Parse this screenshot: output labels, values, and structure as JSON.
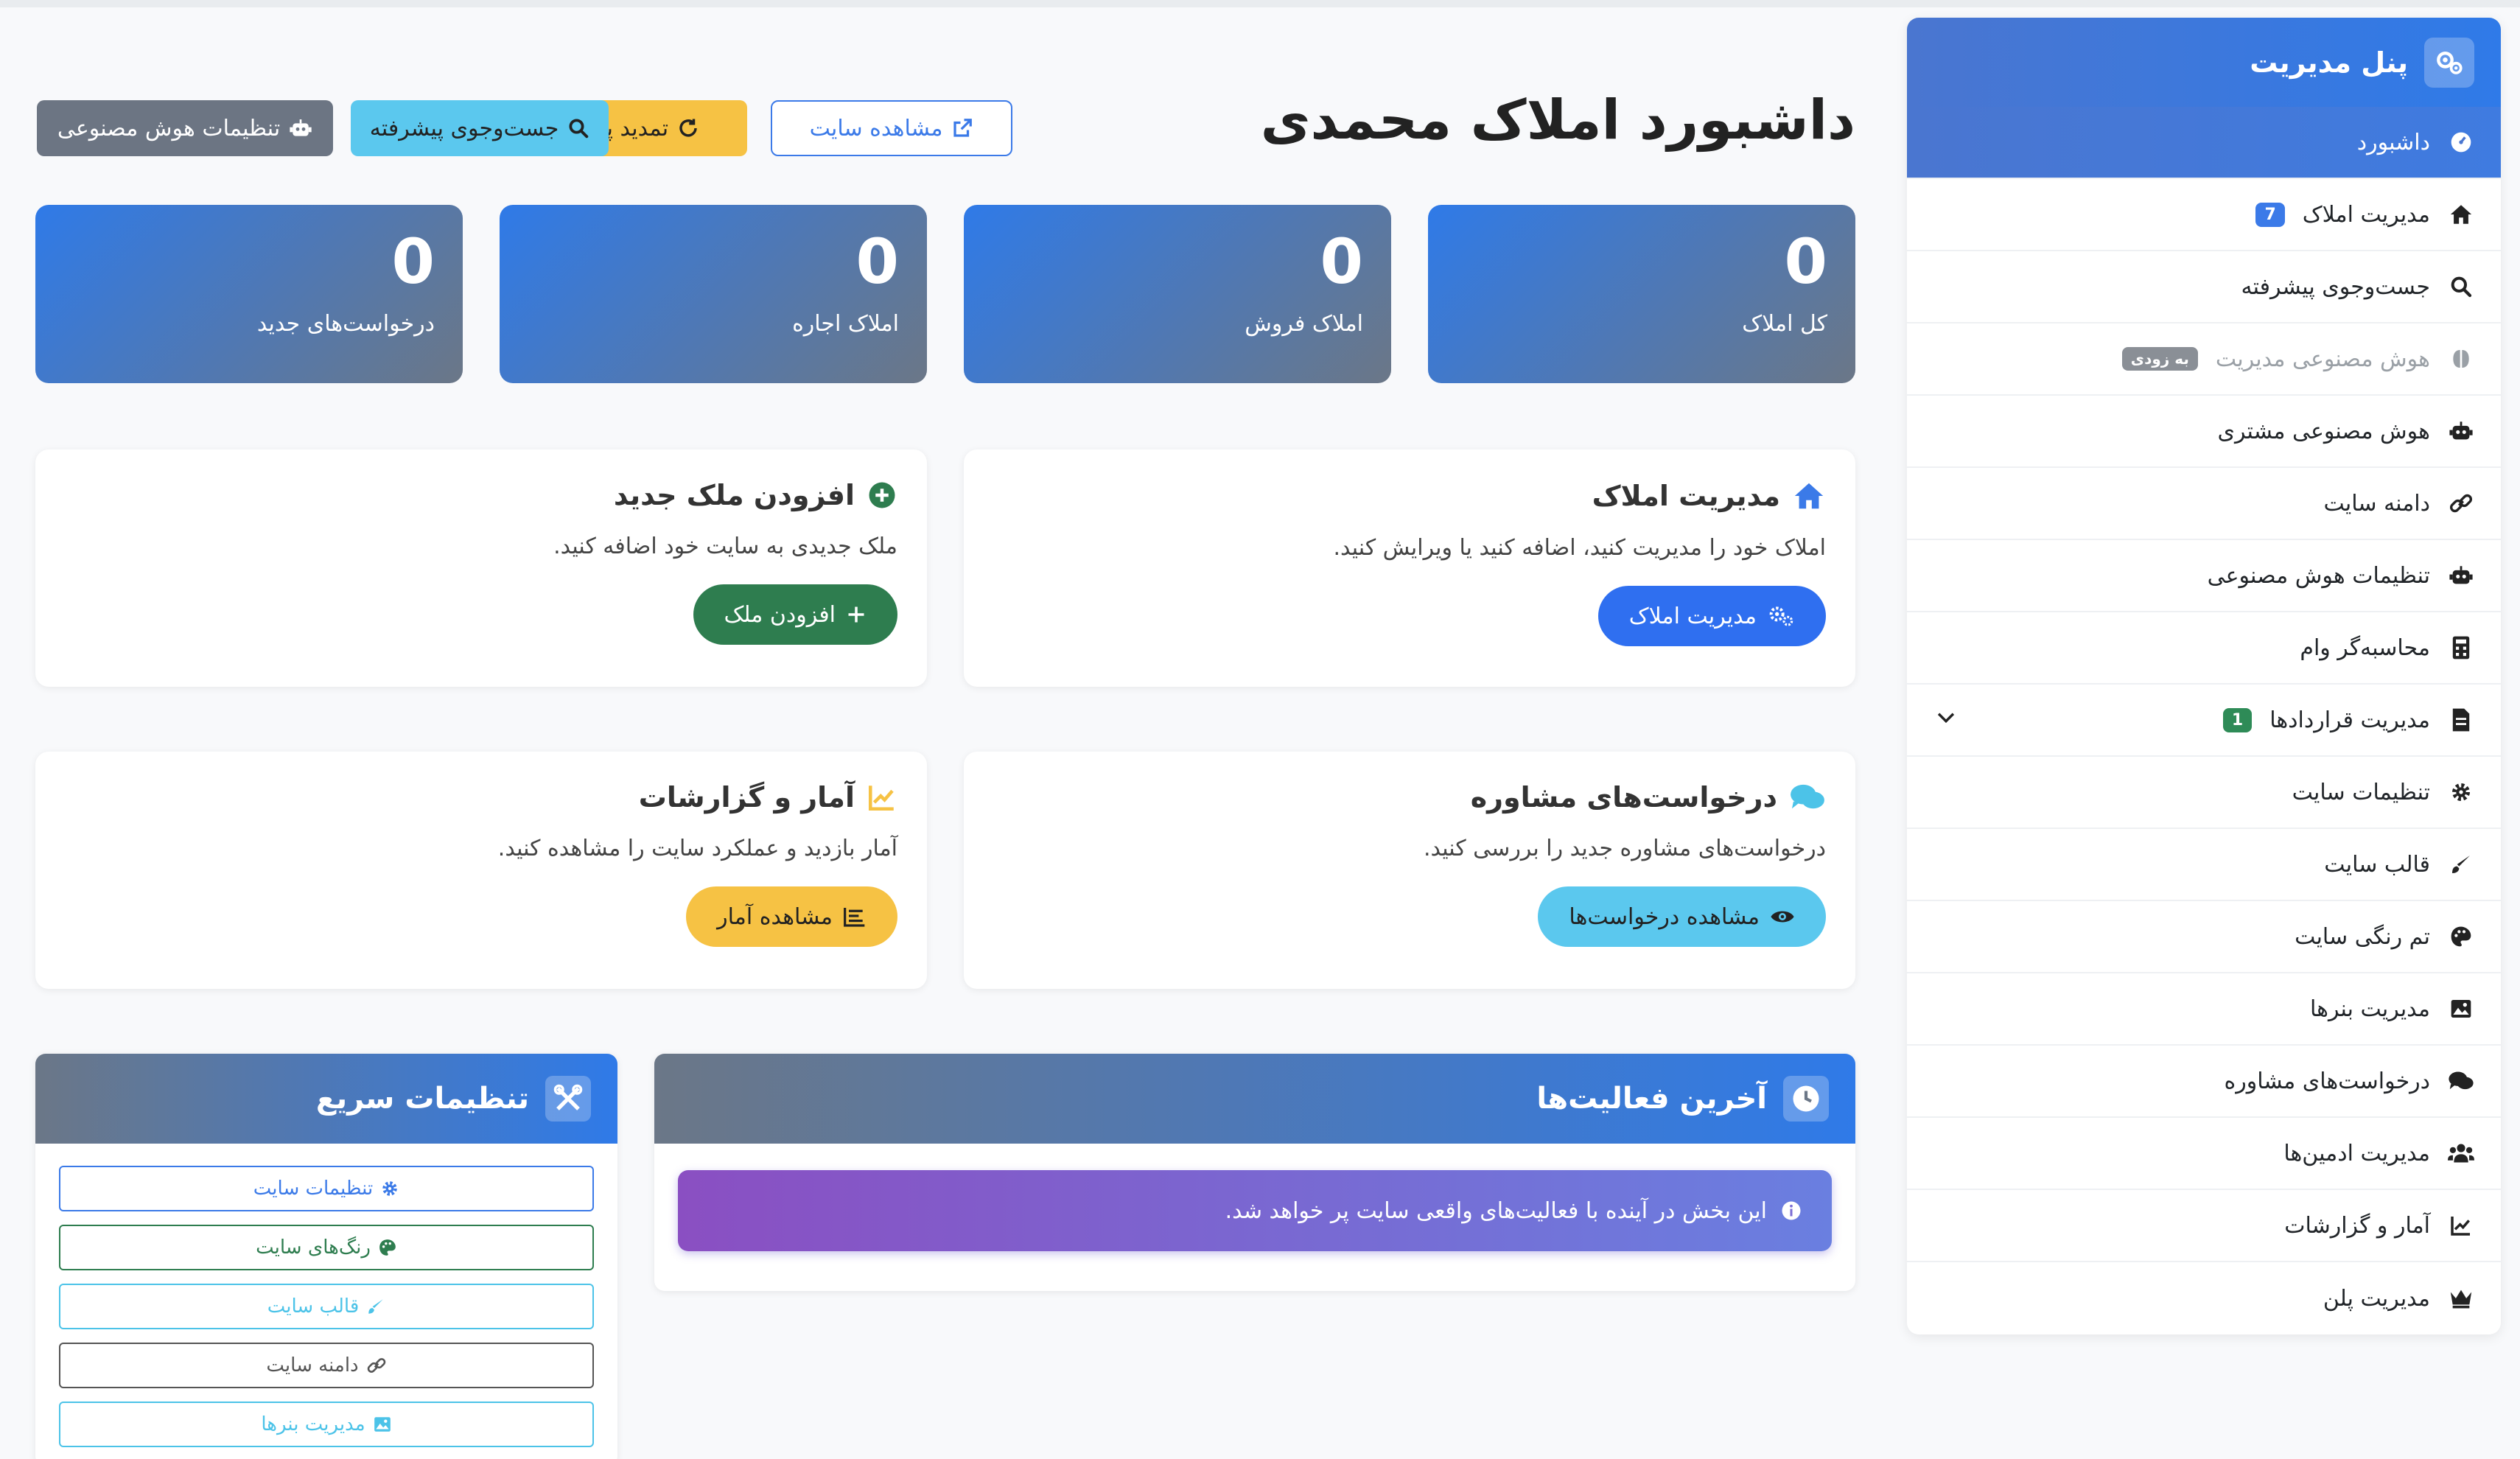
{
  "sidebar": {
    "title": "پنل مدیریت",
    "items": [
      {
        "label": "داشبورد",
        "icon": "dashboard-icon"
      },
      {
        "label": "مدیریت املاک",
        "icon": "home-icon",
        "badge": "7"
      },
      {
        "label": "جست‌وجوی پیشرفته",
        "icon": "search-icon"
      },
      {
        "label": "هوش مصنوعی مدیریت",
        "icon": "brain-icon",
        "badge": "به زودی"
      },
      {
        "label": "هوش مصنوعی مشتری",
        "icon": "robot-icon"
      },
      {
        "label": "دامنه سایت",
        "icon": "link-icon"
      },
      {
        "label": "تنظیمات هوش مصنوعی",
        "icon": "robot-icon"
      },
      {
        "label": "محاسبه‌گر وام",
        "icon": "calculator-icon"
      },
      {
        "label": "مدیریت قراردادها",
        "icon": "file-contract-icon",
        "badge": "1"
      },
      {
        "label": "تنظیمات سایت",
        "icon": "gear-icon"
      },
      {
        "label": "قالب سایت",
        "icon": "brush-icon"
      },
      {
        "label": "تم رنگی سایت",
        "icon": "palette-icon"
      },
      {
        "label": "مدیریت بنرها",
        "icon": "image-icon"
      },
      {
        "label": "درخواست‌های مشاوره",
        "icon": "comments-icon"
      },
      {
        "label": "مدیریت ادمین‌ها",
        "icon": "users-icon"
      },
      {
        "label": "آمار و گزارشات",
        "icon": "chart-line-icon"
      },
      {
        "label": "مدیریت پلن",
        "icon": "crown-icon"
      }
    ]
  },
  "header": {
    "title": "داشبورد املاک محمدی",
    "buttons": {
      "view_site": "مشاهده سایت",
      "renew_plan": "تمدید پلن",
      "advanced_search": "جست‌وجوی پیشرفته",
      "ai_settings": "تنظیمات هوش مصنوعی"
    }
  },
  "stats": [
    {
      "value": "0",
      "label": "کل املاک"
    },
    {
      "value": "0",
      "label": "املاک فروش"
    },
    {
      "value": "0",
      "label": "املاک اجاره"
    },
    {
      "value": "0",
      "label": "درخواست‌های جدید"
    }
  ],
  "cards": {
    "manage": {
      "title": "مدیریت املاک",
      "desc": "املاک خود را مدیریت کنید، اضافه کنید یا ویرایش کنید.",
      "button": "مدیریت املاک"
    },
    "add": {
      "title": "افزودن ملک جدید",
      "desc": "ملک جدیدی به سایت خود اضافه کنید.",
      "button": "افزودن ملک"
    },
    "consult": {
      "title": "درخواست‌های مشاوره",
      "desc": "درخواست‌های مشاوره جدید را بررسی کنید.",
      "button": "مشاهده درخواست‌ها"
    },
    "stats": {
      "title": "آمار و گزارشات",
      "desc": "آمار بازدید و عملکرد سایت را مشاهده کنید.",
      "button": "مشاهده آمار"
    }
  },
  "activities": {
    "title": "آخرین فعالیت‌ها",
    "message": "این بخش در آینده با فعالیت‌های واقعی سایت پر خواهد شد."
  },
  "quick_settings": {
    "title": "تنظیمات سریع",
    "buttons": [
      {
        "label": "تنظیمات سایت",
        "color": "#3b7ae8"
      },
      {
        "label": "رنگ‌های سایت",
        "color": "#2e7d4f"
      },
      {
        "label": "قالب سایت",
        "color": "#4cc3e8"
      },
      {
        "label": "دامنه سایت",
        "color": "#555555"
      },
      {
        "label": "مدیریت بنرها",
        "color": "#4cc3e8"
      }
    ]
  }
}
